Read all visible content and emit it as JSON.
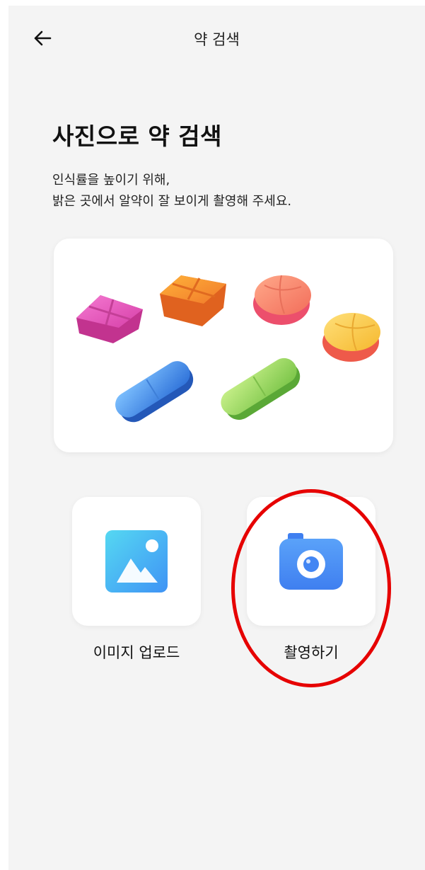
{
  "header": {
    "title": "약 검색"
  },
  "main": {
    "heading": "사진으로 약 검색",
    "desc_line1": "인식률을 높이기 위해,",
    "desc_line2": "밝은 곳에서 알약이 잘 보이게 촬영해 주세요."
  },
  "options": [
    {
      "label": "이미지 업로드",
      "icon": "image-icon"
    },
    {
      "label": "촬영하기",
      "icon": "camera-icon"
    }
  ],
  "colors": {
    "accent_blue": "#4a8cf7",
    "highlight_red": "#e60000",
    "background": "#f4f4f4"
  }
}
